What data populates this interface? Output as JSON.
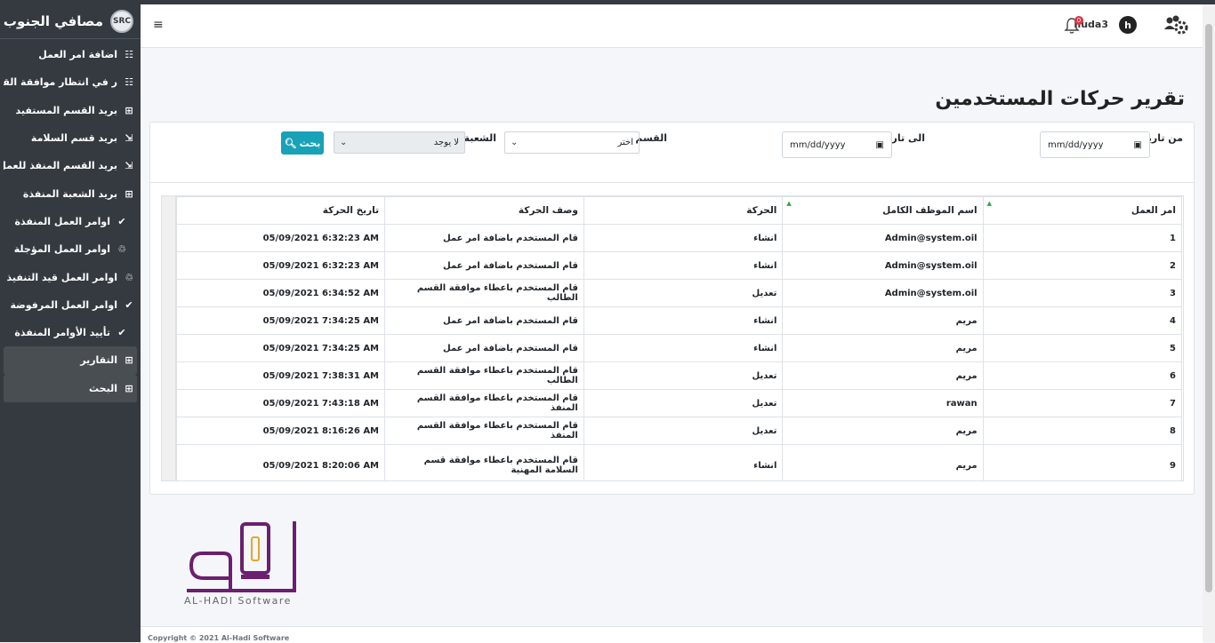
{
  "app": {
    "brand": "مصافي الجنوب",
    "brand_logo_text": "SRC"
  },
  "sidebar": {
    "items": [
      {
        "label": "اضافة امر العمل",
        "icon": "☷"
      },
      {
        "label": "ر في انتظار موافقة القسم",
        "icon": "☷"
      },
      {
        "label": "بريد القسم المستفيد",
        "icon": "⊞"
      },
      {
        "label": "بريد قسم السلامة",
        "icon": "⇲"
      },
      {
        "label": "بريد القسم المنفذ للعمل",
        "icon": "⇲"
      },
      {
        "label": "بريد الشعبة المنفذة",
        "icon": "⊞"
      },
      {
        "label": "اوامر العمل المنفذة",
        "icon": "✔"
      },
      {
        "label": "اوامر العمل المؤجلة",
        "icon": "♲"
      },
      {
        "label": "اوامر العمل قيد التنفيذ",
        "icon": "♲"
      },
      {
        "label": "اوامر العمل المرفوضة",
        "icon": "✔"
      },
      {
        "label": "تأييد الأوامر المنفذة",
        "icon": "✔"
      },
      {
        "label": "التقارير",
        "icon": "⊞"
      },
      {
        "label": "البحث",
        "icon": "⊞"
      }
    ]
  },
  "navbar": {
    "menu_icon": "≡",
    "username": "huda3",
    "avatar_letter": "h",
    "notifications": "0"
  },
  "page": {
    "title": "تقرير حركات المستخدمين"
  },
  "filters": {
    "from_label": "من تاريخ",
    "from_placeholder": "mm/dd/yyyy",
    "to_label": "الى تاريخ",
    "to_placeholder": "mm/dd/yyyy",
    "department_label": "القسم",
    "department_value": "اختر",
    "division_label": "الشعبة",
    "division_value": "لا يوجد",
    "search_label": "بحث"
  },
  "table": {
    "headers": [
      "امر العمل",
      "اسم الموظف الكامل",
      "الحركة",
      "وصف الحركة",
      "تاريخ الحركة"
    ],
    "rows": [
      [
        "1",
        "Admin@system.oil",
        "انشاء",
        "قام المستخدم باضافة امر عمل",
        "05/09/2021 6:32:23 AM"
      ],
      [
        "2",
        "Admin@system.oil",
        "انشاء",
        "قام المستخدم باضافة امر عمل",
        "05/09/2021 6:32:23 AM"
      ],
      [
        "3",
        "Admin@system.oil",
        "تعديل",
        "قام المستخدم باعطاء موافقة القسم الطالب",
        "05/09/2021 6:34:52 AM"
      ],
      [
        "4",
        "مريم",
        "انشاء",
        "قام المستخدم باضافة امر عمل",
        "05/09/2021 7:34:25 AM"
      ],
      [
        "5",
        "مريم",
        "انشاء",
        "قام المستخدم باضافة امر عمل",
        "05/09/2021 7:34:25 AM"
      ],
      [
        "6",
        "مريم",
        "تعديل",
        "قام المستخدم باعطاء موافقة القسم الطالب",
        "05/09/2021 7:38:31 AM"
      ],
      [
        "7",
        "rawan",
        "تعديل",
        "قام المستخدم باعطاء موافقة القسم المنفذ",
        "05/09/2021 7:43:18 AM"
      ],
      [
        "8",
        "مريم",
        "تعديل",
        "قام المستخدم باعطاء موافقة القسم المنفذ",
        "05/09/2021 8:16:26 AM"
      ],
      [
        "9",
        "مريم",
        "انشاء",
        "قام المستخدم باعطاء موافقة قسم السلامة المهنية",
        "05/09/2021 8:20:06 AM"
      ]
    ]
  },
  "logo": {
    "caption": "AL-HADI Software",
    "color": "#6b1f6e",
    "accent": "#e0a82e"
  },
  "footer": {
    "text": "Copyright © 2021 Al-Hadi Software"
  }
}
